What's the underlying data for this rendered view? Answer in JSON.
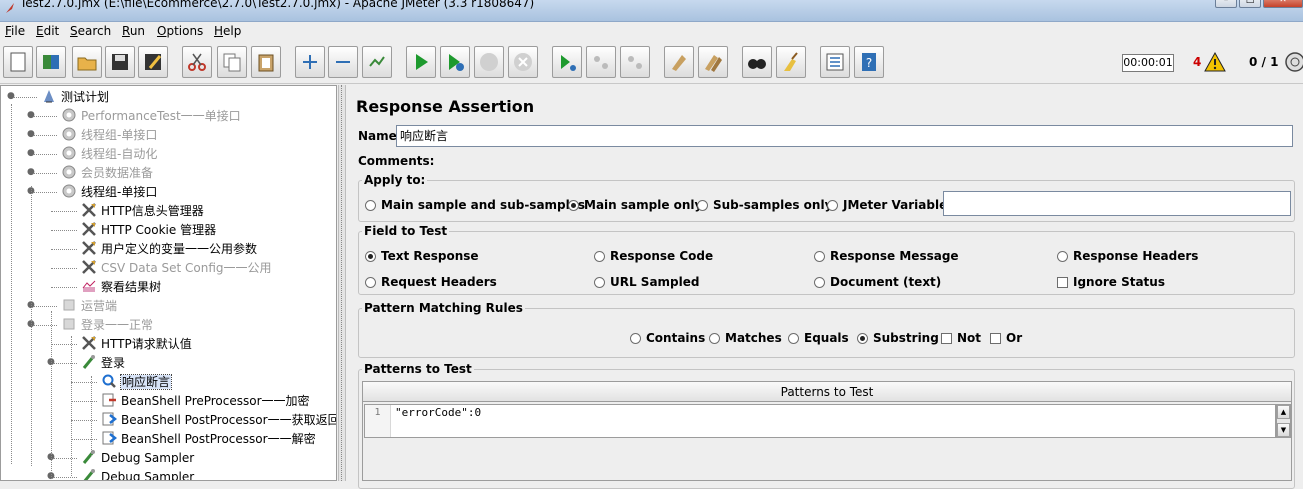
{
  "window": {
    "title": "Test2.7.0.jmx (E:\\file\\Ecommerce\\2.7.0\\Test2.7.0.jmx) - Apache JMeter (3.3 r1808647)"
  },
  "menu": [
    {
      "label": "File",
      "mnemonic": "F"
    },
    {
      "label": "Edit",
      "mnemonic": "E"
    },
    {
      "label": "Search",
      "mnemonic": "S"
    },
    {
      "label": "Run",
      "mnemonic": "R"
    },
    {
      "label": "Options",
      "mnemonic": "O"
    },
    {
      "label": "Help",
      "mnemonic": "H"
    }
  ],
  "toolbar": {
    "icons": [
      "new-icon",
      "templates-icon",
      "open-icon",
      "save-icon",
      "save-as-icon",
      "cut-icon",
      "copy-icon",
      "paste-icon",
      "expand-icon",
      "collapse-icon",
      "toggle-icon",
      "start-icon",
      "start-no-pause-icon",
      "stop-icon",
      "shutdown-icon",
      "remote-start-icon",
      "remote-stop-icon",
      "remote-shutdown-icon",
      "clear-icon",
      "clear-all-icon",
      "search-icon",
      "reset-search-icon",
      "function-helper-icon",
      "help-icon"
    ],
    "timer": "00:00:01",
    "error_count": "4",
    "threads": "0 / 1"
  },
  "tree": {
    "nodes": [
      {
        "label": "测试计划",
        "icon": "test-plan-icon",
        "dim": false
      },
      {
        "label": "PerformanceTest一一单接口",
        "icon": "thread-group-icon",
        "dim": true
      },
      {
        "label": "线程组-单接口",
        "icon": "thread-group-icon",
        "dim": true
      },
      {
        "label": "线程组-自动化",
        "icon": "thread-group-icon",
        "dim": true
      },
      {
        "label": "会员数据准备",
        "icon": "thread-group-icon",
        "dim": true
      },
      {
        "label": "线程组-单接口",
        "icon": "thread-group-icon",
        "dim": false
      },
      {
        "label": "HTTP信息头管理器",
        "icon": "config-tool-icon",
        "dim": false
      },
      {
        "label": "HTTP Cookie 管理器",
        "icon": "config-tool-icon",
        "dim": false
      },
      {
        "label": "用户定义的变量一一公用参数",
        "icon": "config-tool-icon",
        "dim": false
      },
      {
        "label": "CSV Data Set Config一一公用",
        "icon": "config-tool-icon",
        "dim": true
      },
      {
        "label": "察看结果树",
        "icon": "listener-icon",
        "dim": false
      },
      {
        "label": "运营端",
        "icon": "controller-icon",
        "dim": true
      },
      {
        "label": "登录一一正常",
        "icon": "controller-icon",
        "dim": true
      },
      {
        "label": "HTTP请求默认值",
        "icon": "config-tool-icon",
        "dim": false
      },
      {
        "label": "登录",
        "icon": "sampler-icon",
        "dim": false
      },
      {
        "label": "响应断言",
        "icon": "assertion-icon",
        "dim": false,
        "selected": true
      },
      {
        "label": "BeanShell PreProcessor一一加密",
        "icon": "preprocessor-icon",
        "dim": false
      },
      {
        "label": "BeanShell PostProcessor一一获取返回",
        "icon": "postprocessor-icon",
        "dim": false
      },
      {
        "label": "BeanShell PostProcessor一一解密",
        "icon": "postprocessor-icon",
        "dim": false
      },
      {
        "label": "Debug Sampler",
        "icon": "sampler-icon",
        "dim": false
      },
      {
        "label": "Debug Sampler",
        "icon": "sampler-icon",
        "dim": false
      }
    ]
  },
  "panel": {
    "title": "Response Assertion",
    "name_label": "Name:",
    "name_value": "响应断言",
    "comments_label": "Comments:",
    "apply_to": {
      "title": "Apply to:",
      "options": [
        "Main sample and sub-samples",
        "Main sample only",
        "Sub-samples only",
        "JMeter Variable"
      ],
      "selected_index": 1,
      "variable_value": ""
    },
    "field_to_test": {
      "title": "Field to Test",
      "options": [
        "Text Response",
        "Response Code",
        "Response Message",
        "Response Headers",
        "Request Headers",
        "URL Sampled",
        "Document (text)"
      ],
      "selected_index": 0,
      "ignore_status_label": "Ignore Status",
      "ignore_status_checked": false
    },
    "pattern_rules": {
      "title": "Pattern Matching Rules",
      "options": [
        "Contains",
        "Matches",
        "Equals",
        "Substring"
      ],
      "selected_index": 3,
      "not_label": "Not",
      "or_label": "Or"
    },
    "patterns": {
      "title": "Patterns to Test",
      "column_header": "Patterns to Test",
      "line_number": "1",
      "code": "\"errorCode\":0"
    }
  },
  "colors": {
    "titlebar": "#a9c2df",
    "dim_text": "#9a9a9a",
    "error": "#cc0000"
  }
}
